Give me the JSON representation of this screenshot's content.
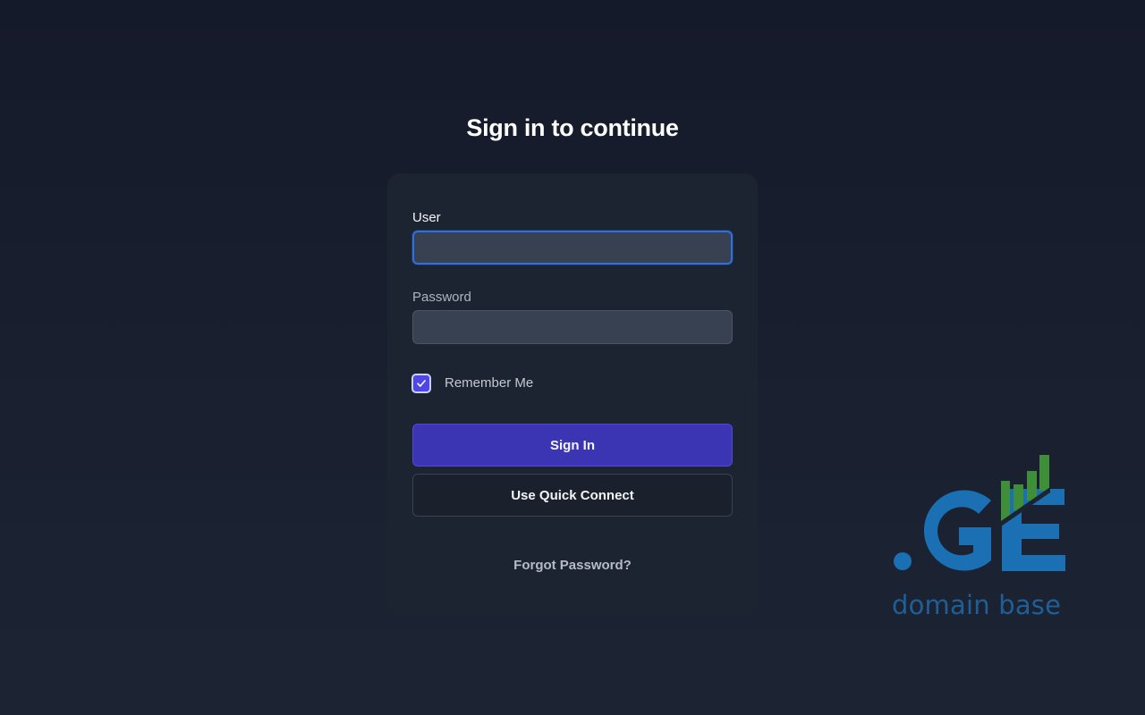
{
  "page": {
    "title": "Sign in to continue"
  },
  "form": {
    "user_label": "User",
    "user_value": "",
    "password_label": "Password",
    "password_value": "",
    "remember_label": "Remember Me",
    "remember_checked": true,
    "signin_label": "Sign In",
    "quick_connect_label": "Use Quick Connect",
    "forgot_label": "Forgot Password?"
  },
  "watermark": {
    "logo_text": ".GE",
    "caption": "domain base",
    "blue": "#1b6fb3",
    "green": "#3f8f3a"
  },
  "colors": {
    "accent": "#3b35b3",
    "focus": "#2f6fe0",
    "card": "#1c2331"
  }
}
